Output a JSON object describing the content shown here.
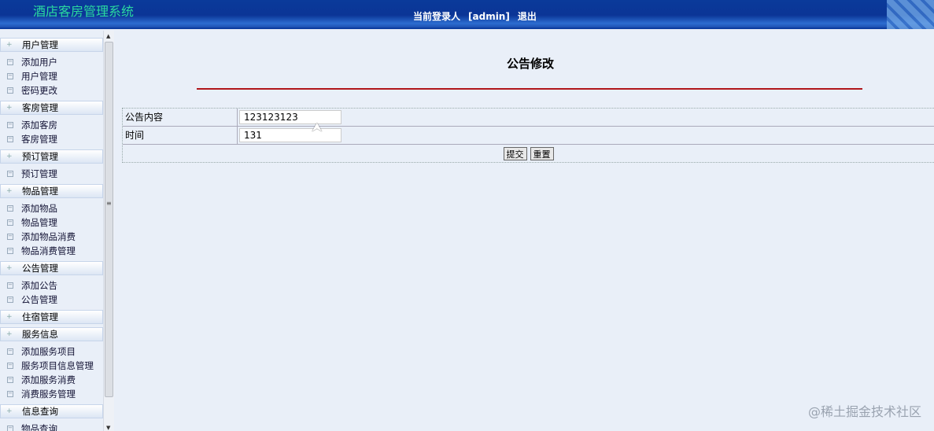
{
  "header": {
    "title": "酒店客房管理系统",
    "user_label": "当前登录人",
    "user": "[admin]",
    "logout": "退出"
  },
  "sidebar": [
    {
      "title": "用户管理",
      "items": [
        "添加用户",
        "用户管理",
        "密码更改"
      ]
    },
    {
      "title": "客房管理",
      "items": [
        "添加客房",
        "客房管理"
      ]
    },
    {
      "title": "预订管理",
      "items": [
        "预订管理"
      ]
    },
    {
      "title": "物品管理",
      "items": [
        "添加物品",
        "物品管理",
        "添加物品消费",
        "物品消费管理"
      ]
    },
    {
      "title": "公告管理",
      "items": [
        "添加公告",
        "公告管理"
      ]
    },
    {
      "title": "住宿管理",
      "items": []
    },
    {
      "title": "服务信息",
      "items": [
        "添加服务项目",
        "服务项目信息管理",
        "添加服务消费",
        "消费服务管理"
      ]
    },
    {
      "title": "信息查询",
      "items": [
        "物品查询"
      ]
    }
  ],
  "main": {
    "title": "公告修改",
    "fields": [
      {
        "label": "公告内容",
        "value": "123123123"
      },
      {
        "label": "时间",
        "value": "131"
      }
    ],
    "submit": "提交",
    "reset": "重置"
  },
  "watermark": "@稀土掘金技术社区"
}
